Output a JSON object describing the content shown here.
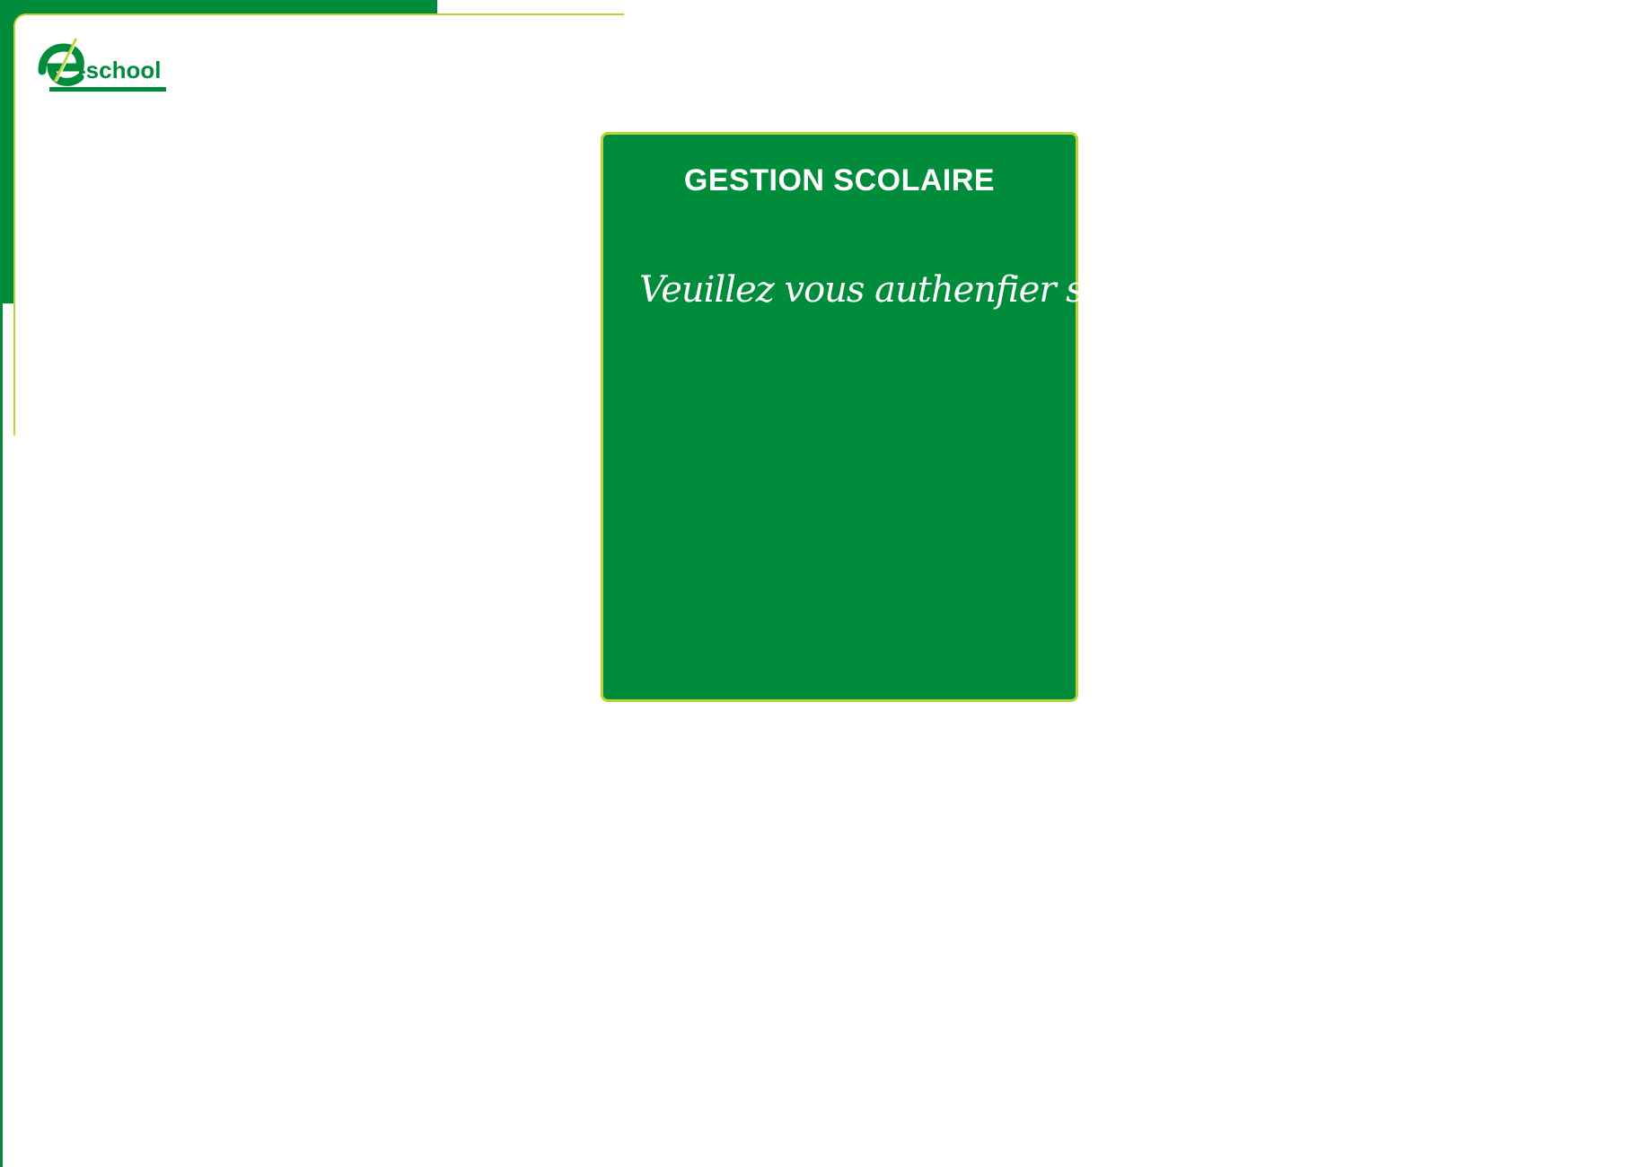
{
  "logo": {
    "text": "-school",
    "icon": "e-letter-logo-icon"
  },
  "card": {
    "title": "GESTION SCOLAIRE",
    "subtitle": "Veuillez vous authenfier svp..."
  },
  "colors": {
    "brand_green": "#008c3a",
    "accent_lime": "#b7d433",
    "background": "#ffffff"
  }
}
